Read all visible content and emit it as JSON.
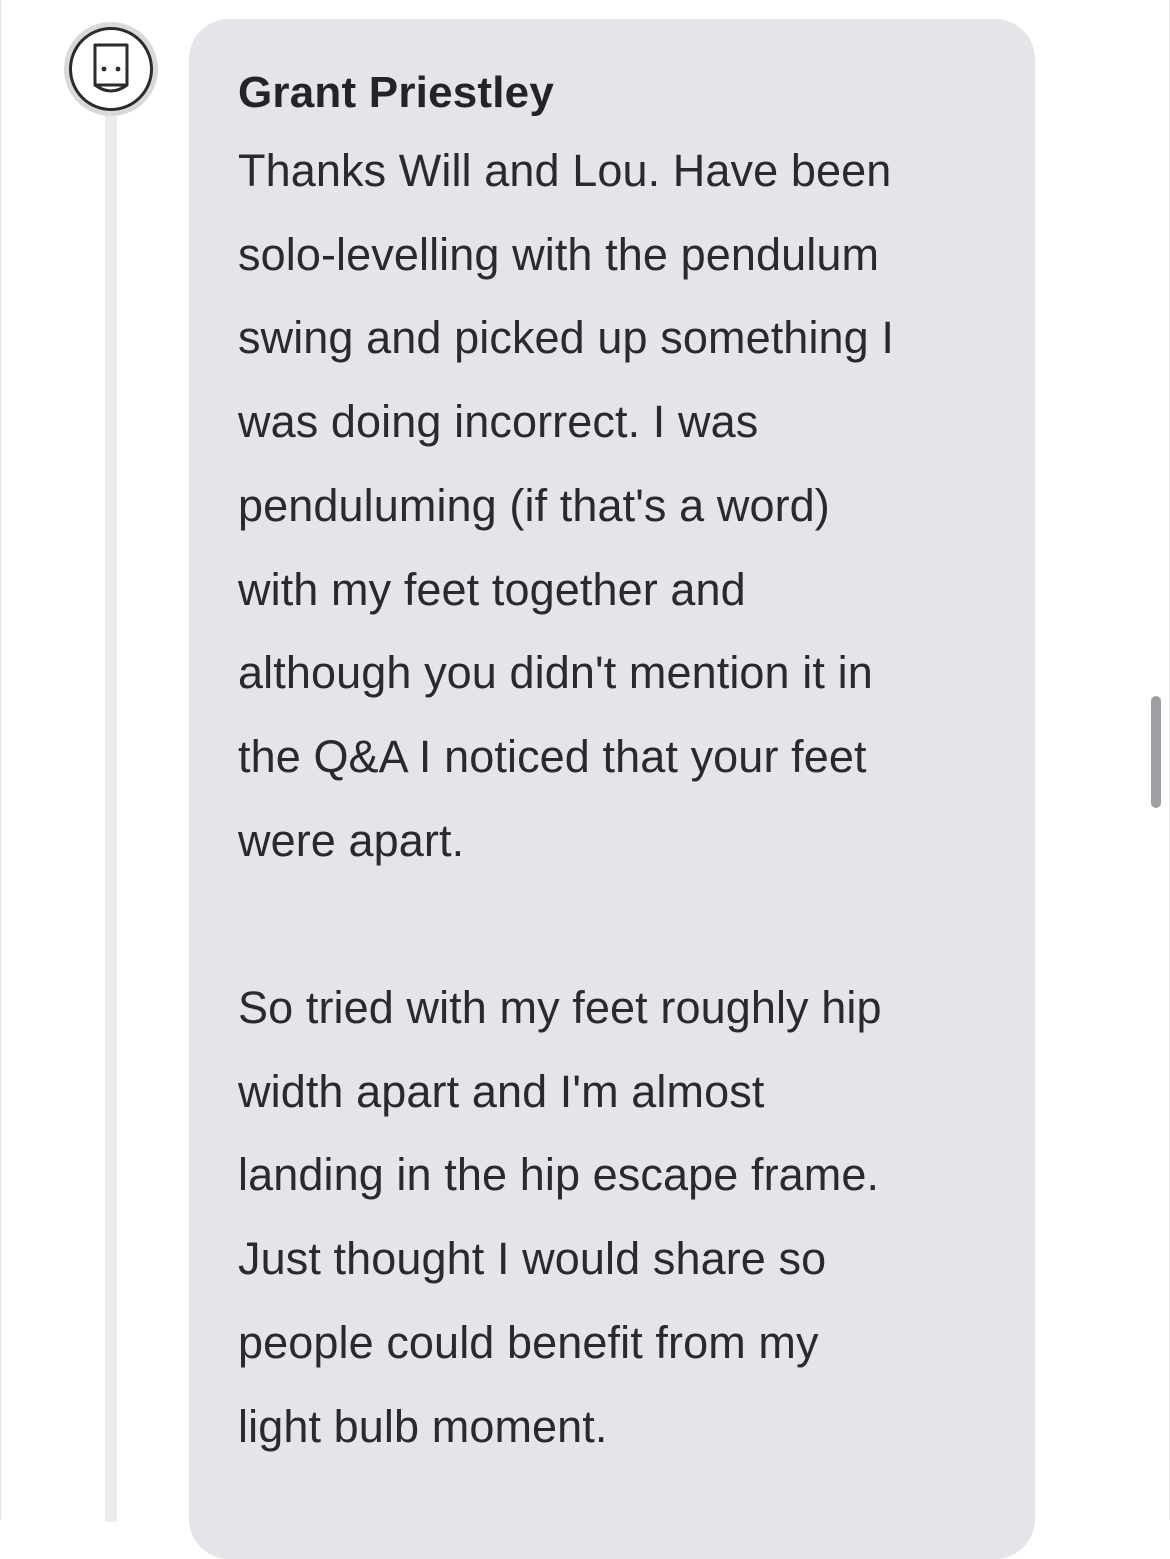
{
  "comment": {
    "author": "Grant Priestley",
    "avatar_icon": "paper-bag-face-icon",
    "lines": [
      "Thanks Will and Lou. Have been",
      "solo-levelling with the pendulum",
      "swing and picked up something I",
      "was doing incorrect. I was",
      "penduluming (if that's a word)",
      "with my feet together and",
      "although you didn't mention it in",
      "the Q&A I noticed that your feet",
      "were apart.",
      "",
      "So tried with my feet roughly hip",
      "width apart and I'm almost",
      "landing in the hip escape frame.",
      "Just thought I would share so",
      "people could benefit from my",
      "light bulb moment."
    ]
  },
  "colors": {
    "bubble": "#e5e5e9",
    "thread_line": "#ececef",
    "text": "#2a2a2e",
    "scrollbar": "#9e9ea3"
  }
}
